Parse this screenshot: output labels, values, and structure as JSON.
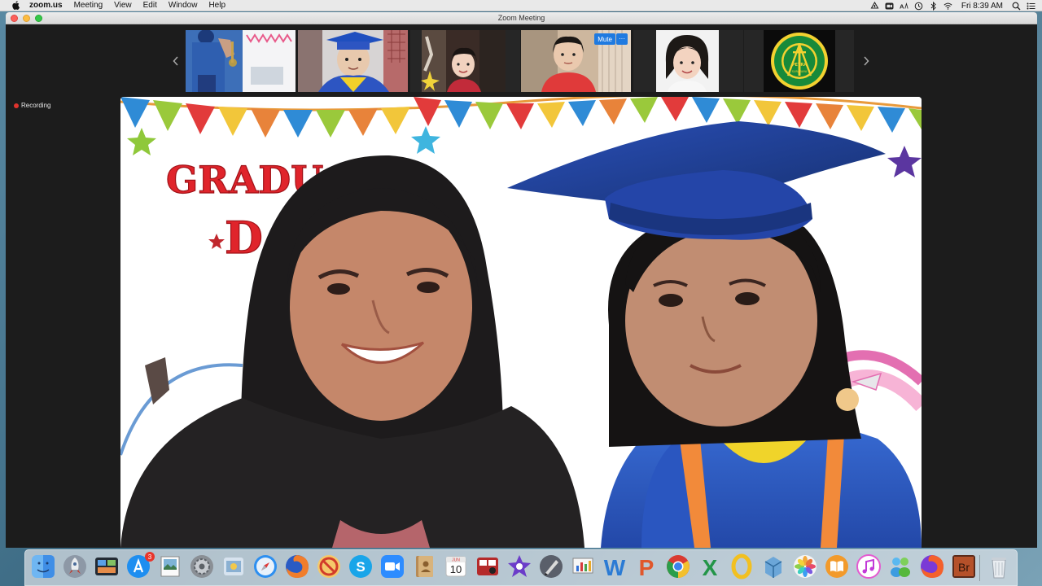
{
  "menubar": {
    "app_name": "zoom.us",
    "menus": [
      "Meeting",
      "View",
      "Edit",
      "Window",
      "Help"
    ],
    "clock": "Fri 8:39 AM"
  },
  "window": {
    "title": "Zoom Meeting"
  },
  "gallery": {
    "hover_controls": {
      "mute_label": "Mute",
      "more_label": "···"
    },
    "logo": {
      "ring_text": "PERHIMPUNAN PENDIDIKAN DAN PENGAJARAN KRISTEN",
      "word": "PETRA",
      "city": "SURABAYA"
    }
  },
  "status": {
    "recording_label": "Recording"
  },
  "main_video": {
    "banner_text_1": "GRADUA",
    "banner_text_2": "D"
  },
  "dock": {
    "items": [
      {
        "name": "finder"
      },
      {
        "name": "launchpad"
      },
      {
        "name": "mission-control"
      },
      {
        "name": "app-store",
        "badge": "3"
      },
      {
        "name": "preview"
      },
      {
        "name": "system-preferences"
      },
      {
        "name": "photo-booth"
      },
      {
        "name": "safari"
      },
      {
        "name": "firefox"
      },
      {
        "name": "no-entry"
      },
      {
        "name": "skype"
      },
      {
        "name": "zoom"
      },
      {
        "name": "contacts"
      },
      {
        "name": "calendar",
        "date": "10",
        "month": "JUN"
      },
      {
        "name": "photo-booth-red"
      },
      {
        "name": "imovie"
      },
      {
        "name": "script-editor"
      },
      {
        "name": "keynote"
      },
      {
        "name": "word",
        "letter": "W"
      },
      {
        "name": "powerpoint",
        "letter": "P"
      },
      {
        "name": "chrome"
      },
      {
        "name": "excel",
        "letter": "X"
      },
      {
        "name": "outlook",
        "letter": "O"
      },
      {
        "name": "archive"
      },
      {
        "name": "photos"
      },
      {
        "name": "ibooks"
      },
      {
        "name": "itunes"
      },
      {
        "name": "messenger"
      },
      {
        "name": "firefox-2"
      },
      {
        "name": "bridge",
        "letter": "Br"
      },
      {
        "name": "trash"
      }
    ]
  },
  "colors": {
    "zoom_blue": "#1f7ae0",
    "recording_red": "#e0332d",
    "window_bg": "#1c1c1c"
  }
}
